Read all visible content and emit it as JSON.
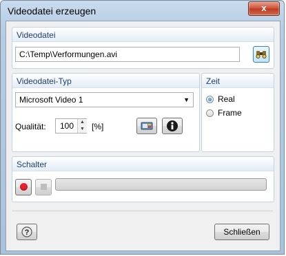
{
  "window": {
    "title": "Videodatei erzeugen",
    "close_glyph": "x"
  },
  "videodatei": {
    "group_title": "Videodatei",
    "path": "C:\\Temp\\Verformungen.avi",
    "browse_icon": "binoculars-icon"
  },
  "typ": {
    "group_title": "Videodatei-Typ",
    "codec_selected": "Microsoft Video 1",
    "quality_label": "Qualität:",
    "quality_value": "100",
    "quality_unit": "[%]",
    "settings_icon": "codec-settings-icon",
    "info_icon": "info-icon"
  },
  "zeit": {
    "group_title": "Zeit",
    "options": [
      {
        "label": "Real",
        "selected": true
      },
      {
        "label": "Frame",
        "selected": false
      }
    ]
  },
  "schalter": {
    "group_title": "Schalter",
    "record_icon": "record-icon",
    "stop_icon": "stop-icon",
    "progress": 0
  },
  "footer": {
    "help_icon": "help-icon",
    "close_label": "Schließen"
  },
  "colors": {
    "record": "#e8232a",
    "accent": "#1e3e6b"
  }
}
